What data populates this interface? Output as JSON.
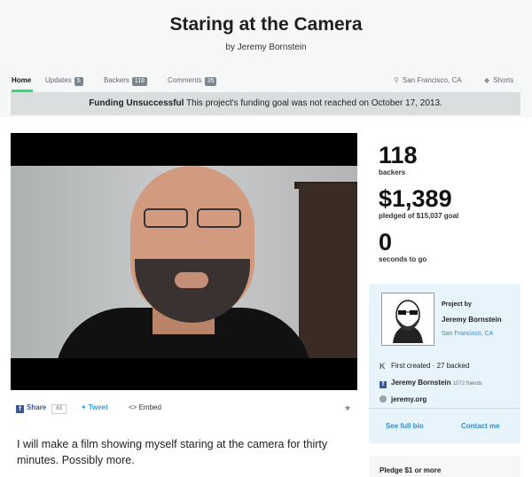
{
  "project": {
    "title": "Staring at the Camera",
    "byline": "by Jeremy Bornstein"
  },
  "nav": {
    "tabs": [
      {
        "label": "Home",
        "count": null
      },
      {
        "label": "Updates",
        "count": "5"
      },
      {
        "label": "Backers",
        "count": "118"
      },
      {
        "label": "Comments",
        "count": "35"
      }
    ],
    "location": "San Francisco, CA",
    "category": "Shorts"
  },
  "banner": {
    "status": "Funding Unsuccessful",
    "message": "This project's funding goal was not reached on October 17, 2013."
  },
  "stats": {
    "backers_count": "118",
    "backers_label": "backers",
    "pledged_amount": "$1,389",
    "pledged_label": "pledged of $15,037 goal",
    "time_left": "0",
    "time_label": "seconds to go"
  },
  "creator": {
    "heading": "Project by",
    "name": "Jeremy Bornstein",
    "location": "San Francisco, CA",
    "history": "First created · 27 backed",
    "facebook_name": "Jeremy Bornstein",
    "facebook_friends": "1072 friends",
    "website": "jeremy.org",
    "full_bio_label": "See full bio",
    "contact_label": "Contact me"
  },
  "share": {
    "share_label": "Share",
    "share_count": "83",
    "tweet_label": "Tweet",
    "embed_label": "Embed"
  },
  "description": "I will make a film showing myself staring at the camera for thirty minutes. Possibly more.",
  "pledge": {
    "label": "Pledge $1 or more"
  },
  "colors": {
    "accent": "#2bde73",
    "link": "#2b8ed1",
    "banner_bg": "#dadedf",
    "creator_bg": "#e7f4fb"
  }
}
